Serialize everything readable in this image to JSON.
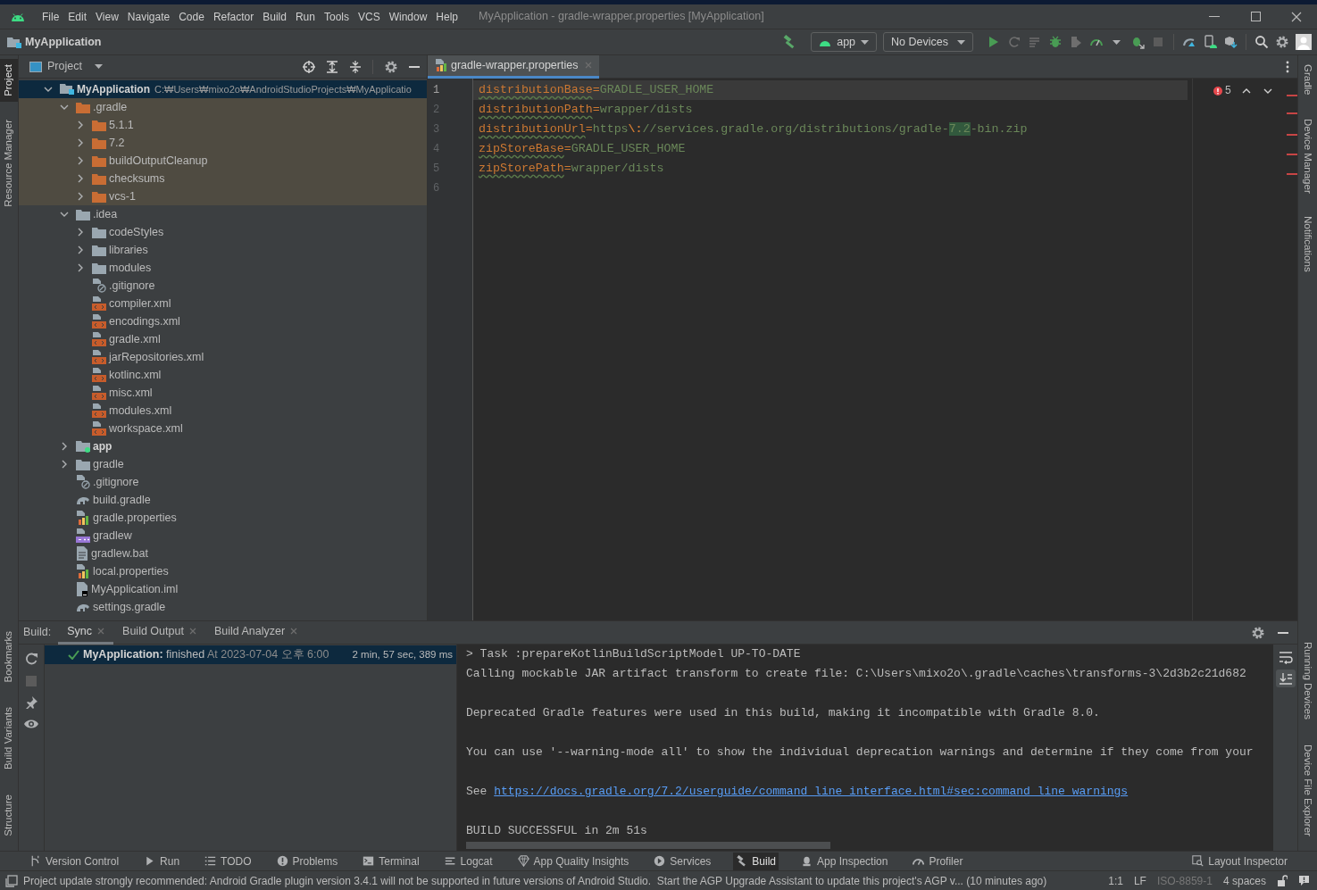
{
  "window": {
    "title": "MyApplication - gradle-wrapper.properties [MyApplication]"
  },
  "menu": [
    "File",
    "Edit",
    "View",
    "Navigate",
    "Code",
    "Refactor",
    "Build",
    "Run",
    "Tools",
    "VCS",
    "Window",
    "Help"
  ],
  "toolbar": {
    "project": "MyApplication",
    "configuration": "app",
    "device": "No Devices"
  },
  "left_stripe": {
    "top": [
      {
        "label": "Project",
        "selected": true
      },
      {
        "label": "Resource Manager",
        "selected": false
      }
    ],
    "bottom": [
      {
        "label": "Bookmarks",
        "selected": false
      },
      {
        "label": "Build Variants",
        "selected": false
      },
      {
        "label": "Structure",
        "selected": false
      }
    ]
  },
  "right_stripe": {
    "top": [
      {
        "label": "Gradle",
        "selected": false
      },
      {
        "label": "Device Manager",
        "selected": false
      },
      {
        "label": "Notifications",
        "selected": false
      }
    ],
    "bottom": [
      {
        "label": "Running Devices",
        "selected": false
      },
      {
        "label": "Device File Explorer",
        "selected": false
      }
    ]
  },
  "project_panel": {
    "title": "Project",
    "tree": [
      {
        "label": "MyApplication",
        "path": "C:₩Users₩mixo2o₩AndroidStudioProjects₩MyApplicatio",
        "kind": "project",
        "expanded": true,
        "selected": true,
        "excluded": false,
        "children": [
          {
            "label": ".gradle",
            "kind": "folder",
            "expanded": true,
            "selected": false,
            "excluded": true,
            "children": [
              {
                "label": "5.1.1",
                "kind": "folder",
                "expanded": false,
                "selected": false,
                "excluded": true
              },
              {
                "label": "7.2",
                "kind": "folder",
                "expanded": false,
                "selected": false,
                "excluded": true
              },
              {
                "label": "buildOutputCleanup",
                "kind": "folder",
                "expanded": false,
                "selected": false,
                "excluded": true
              },
              {
                "label": "checksums",
                "kind": "folder",
                "expanded": false,
                "selected": false,
                "excluded": true
              },
              {
                "label": "vcs-1",
                "kind": "folder",
                "expanded": false,
                "selected": false,
                "excluded": true
              }
            ]
          },
          {
            "label": ".idea",
            "kind": "folder",
            "expanded": true,
            "selected": false,
            "excluded": false,
            "children": [
              {
                "label": "codeStyles",
                "kind": "folder",
                "expanded": false,
                "selected": false,
                "excluded": false
              },
              {
                "label": "libraries",
                "kind": "folder",
                "expanded": false,
                "selected": false,
                "excluded": false
              },
              {
                "label": "modules",
                "kind": "folder",
                "expanded": false,
                "selected": false,
                "excluded": false
              },
              {
                "label": ".gitignore",
                "kind": "ignore",
                "selected": false,
                "excluded": false
              },
              {
                "label": "compiler.xml",
                "kind": "xml",
                "selected": false,
                "excluded": false
              },
              {
                "label": "encodings.xml",
                "kind": "xml",
                "selected": false,
                "excluded": false
              },
              {
                "label": "gradle.xml",
                "kind": "xml",
                "selected": false,
                "excluded": false
              },
              {
                "label": "jarRepositories.xml",
                "kind": "xml",
                "selected": false,
                "excluded": false
              },
              {
                "label": "kotlinc.xml",
                "kind": "xml",
                "selected": false,
                "excluded": false
              },
              {
                "label": "misc.xml",
                "kind": "xml",
                "selected": false,
                "excluded": false
              },
              {
                "label": "modules.xml",
                "kind": "xml",
                "selected": false,
                "excluded": false
              },
              {
                "label": "workspace.xml",
                "kind": "xml",
                "selected": false,
                "excluded": false
              }
            ]
          },
          {
            "label": "app",
            "kind": "module",
            "expanded": false,
            "selected": false,
            "excluded": false
          },
          {
            "label": "gradle",
            "kind": "folder",
            "expanded": false,
            "selected": false,
            "excluded": false
          },
          {
            "label": ".gitignore",
            "kind": "ignore",
            "selected": false,
            "excluded": false
          },
          {
            "label": "build.gradle",
            "kind": "gradle",
            "selected": false,
            "excluded": false
          },
          {
            "label": "gradle.properties",
            "kind": "properties",
            "selected": false,
            "excluded": false
          },
          {
            "label": "gradlew",
            "kind": "script",
            "selected": false,
            "excluded": false
          },
          {
            "label": "gradlew.bat",
            "kind": "text",
            "selected": false,
            "excluded": false
          },
          {
            "label": "local.properties",
            "kind": "properties",
            "selected": false,
            "excluded": false
          },
          {
            "label": "MyApplication.iml",
            "kind": "iml",
            "selected": false,
            "excluded": false
          },
          {
            "label": "settings.gradle",
            "kind": "gradle",
            "selected": false,
            "excluded": false
          }
        ]
      }
    ]
  },
  "editor": {
    "tab": {
      "label": "gradle-wrapper.properties",
      "selected": true
    },
    "problems": "5",
    "lines": [
      {
        "number": "1",
        "current": true,
        "segments": [
          {
            "text": "distributionBase",
            "kind": "key"
          },
          {
            "text": "=",
            "kind": "sep"
          },
          {
            "text": "GRADLE_USER_HOME",
            "kind": "value"
          }
        ]
      },
      {
        "number": "2",
        "current": false,
        "segments": [
          {
            "text": "distributionPath",
            "kind": "key"
          },
          {
            "text": "=",
            "kind": "sep"
          },
          {
            "text": "wrapper/dists",
            "kind": "value"
          }
        ]
      },
      {
        "number": "3",
        "current": false,
        "segments": [
          {
            "text": "distributionUrl",
            "kind": "key"
          },
          {
            "text": "=",
            "kind": "sep"
          },
          {
            "text": "https",
            "kind": "value"
          },
          {
            "text": "\\:",
            "kind": "escape"
          },
          {
            "text": "//services.gradle.org/distributions/gradle-",
            "kind": "value"
          },
          {
            "text": "7.2",
            "kind": "match"
          },
          {
            "text": "-bin.zip",
            "kind": "value"
          }
        ]
      },
      {
        "number": "4",
        "current": false,
        "segments": [
          {
            "text": "zipStoreBase",
            "kind": "key"
          },
          {
            "text": "=",
            "kind": "sep"
          },
          {
            "text": "GRADLE_USER_HOME",
            "kind": "value"
          }
        ]
      },
      {
        "number": "5",
        "current": false,
        "segments": [
          {
            "text": "zipStorePath",
            "kind": "key"
          },
          {
            "text": "=",
            "kind": "sep"
          },
          {
            "text": "wrapper/dists",
            "kind": "value"
          }
        ]
      },
      {
        "number": "6",
        "current": false
      }
    ]
  },
  "build_panel": {
    "label": "Build:",
    "tabs": [
      {
        "label": "Sync",
        "selected": true
      },
      {
        "label": "Build Output",
        "selected": false
      },
      {
        "label": "Build Analyzer",
        "selected": false
      }
    ],
    "result": {
      "name": "MyApplication:",
      "status": "finished",
      "time": "At 2023-07-04 오후 6:00",
      "duration": "2 min, 57 sec, 389 ms",
      "selected": true
    },
    "console": [
      [
        {
          "kind": "text",
          "text": "> Task :prepareKotlinBuildScriptModel UP-TO-DATE"
        },
        {
          "kind": "text",
          "text": "Calling mockable JAR artifact transform to create file: C:\\Users\\mixo2o\\.gradle\\caches\\transforms-3\\2d3b2c21d682"
        }
      ],
      [
        {
          "kind": "text",
          "text": "Deprecated Gradle features were used in this build, making it incompatible with Gradle 8.0."
        }
      ],
      [
        {
          "kind": "text",
          "text": "You can use '--warning-mode all' to show the individual deprecation warnings and determine if they come from your"
        }
      ],
      [
        {
          "kind": "link",
          "text": "See ",
          "url": "https://docs.gradle.org/7.2/userguide/command_line_interface.html#sec:command_line_warnings"
        }
      ],
      [
        {
          "kind": "text",
          "text": "BUILD SUCCESSFUL in 2m 51s"
        }
      ]
    ]
  },
  "tool_windows": [
    {
      "label": "Version Control",
      "selected": false
    },
    {
      "label": "Run",
      "selected": false
    },
    {
      "label": "TODO",
      "selected": false
    },
    {
      "label": "Problems",
      "selected": false
    },
    {
      "label": "Terminal",
      "selected": false
    },
    {
      "label": "Logcat",
      "selected": false
    },
    {
      "label": "App Quality Insights",
      "selected": false
    },
    {
      "label": "Services",
      "selected": false
    },
    {
      "label": "Build",
      "selected": true
    },
    {
      "label": "App Inspection",
      "selected": false
    },
    {
      "label": "Profiler",
      "selected": false
    },
    {
      "label": "Layout Inspector",
      "selected": false
    }
  ],
  "status_bar": {
    "message": "Project update strongly recommended: Android Gradle plugin version 3.4.1 will not be supported in future versions of Android Studio.  Start the AGP Upgrade Assistant to update this project's AGP v... (10 minutes ago)",
    "items": [
      {
        "label": "1:1",
        "disabled": false
      },
      {
        "label": "LF",
        "disabled": false
      },
      {
        "label": "ISO-8859-1",
        "disabled": true
      },
      {
        "label": "4 spaces",
        "disabled": false
      }
    ]
  }
}
